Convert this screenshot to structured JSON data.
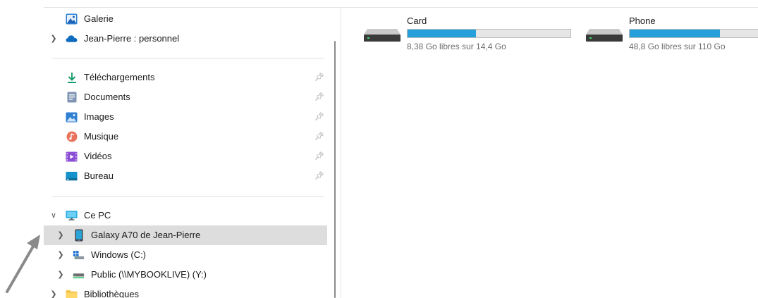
{
  "navigation": {
    "quick_items": [
      {
        "label": "Galerie",
        "icon": "gallery-icon"
      },
      {
        "label": "Jean-Pierre : personnel",
        "icon": "onedrive-cloud-icon",
        "expand": "chevron-right-icon"
      }
    ],
    "pinned_items": [
      {
        "label": "Téléchargements",
        "icon": "download-icon",
        "pin": "pin-icon"
      },
      {
        "label": "Documents",
        "icon": "documents-icon",
        "pin": "pin-icon"
      },
      {
        "label": "Images",
        "icon": "pictures-icon",
        "pin": "pin-icon"
      },
      {
        "label": "Musique",
        "icon": "music-icon",
        "pin": "pin-icon"
      },
      {
        "label": "Vidéos",
        "icon": "videos-icon",
        "pin": "pin-icon"
      },
      {
        "label": "Bureau",
        "icon": "desktop-folder-icon",
        "pin": "pin-icon"
      }
    ],
    "this_pc": {
      "label": "Ce PC",
      "icon": "computer-monitor-icon",
      "expand": "chevron-down-icon",
      "children": [
        {
          "label": "Galaxy A70 de Jean-Pierre",
          "icon": "phone-device-icon",
          "selected": true
        },
        {
          "label": "Windows (C:)",
          "icon": "windows-drive-icon",
          "selected": false
        },
        {
          "label": "Public (\\\\MYBOOKLIVE) (Y:)",
          "icon": "network-drive-icon",
          "selected": false
        }
      ]
    },
    "libraries": {
      "label": "Bibliothèques",
      "icon": "libraries-folder-icon"
    }
  },
  "drives": [
    {
      "name": "Card",
      "free_text": "8,38 Go libres sur 14,4 Go",
      "used_fraction": 0.418,
      "icon": "storage-drive-icon"
    },
    {
      "name": "Phone",
      "free_text": "48,8 Go libres sur 110 Go",
      "used_fraction": 0.556,
      "icon": "storage-drive-icon"
    }
  ],
  "colors": {
    "accent": "#26a0da",
    "selection": "#dddddd",
    "folder": "#f4c34b"
  }
}
